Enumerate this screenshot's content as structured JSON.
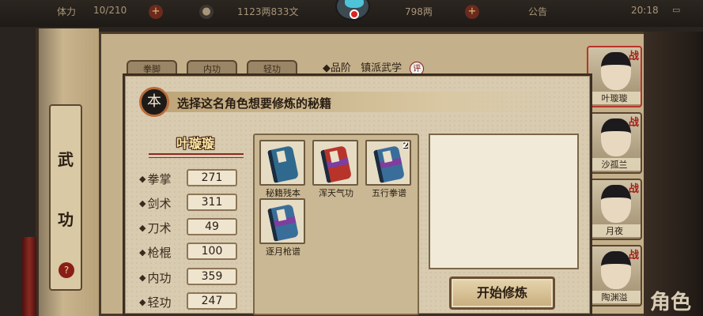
{
  "topbar": {
    "stamina": "10/210",
    "coins": "1123两833文",
    "gems": "798两",
    "notice": "公告",
    "clock": "20:18"
  },
  "scroll": {
    "label_1": "武",
    "label_2": "功",
    "help_icon": "?"
  },
  "background_panel": {
    "tabs": [
      "拳脚",
      "内功",
      "轻功"
    ],
    "grade_label": "◆品阶",
    "grade_value": "镇派武学",
    "grade_seal": "评"
  },
  "roster": [
    {
      "name": "叶璇璇",
      "mark": "战"
    },
    {
      "name": "沙孤兰",
      "mark": "战"
    },
    {
      "name": "月夜",
      "mark": "战"
    },
    {
      "name": "陶渊溢",
      "mark": "战"
    }
  ],
  "corner_text": "角色",
  "dialog": {
    "badge": "本",
    "title": "选择这名角色想要修炼的秘籍",
    "character": "叶璇璇",
    "stats": [
      {
        "label": "拳掌",
        "value": "271"
      },
      {
        "label": "剑术",
        "value": "311"
      },
      {
        "label": "刀术",
        "value": "49"
      },
      {
        "label": "枪棍",
        "value": "100"
      },
      {
        "label": "内功",
        "value": "359"
      },
      {
        "label": "轻功",
        "value": "247"
      }
    ],
    "books": [
      {
        "name": "秘籍残本",
        "count": "",
        "color": "#2f6a8e",
        "band": "#2f6a8e"
      },
      {
        "name": "浑天气功",
        "count": "",
        "color": "#b8342a",
        "band": "#7d3ea0"
      },
      {
        "name": "五行拳谱",
        "count": "2",
        "color": "#3a6e9a",
        "band": "#7d3ea0"
      },
      {
        "name": "逐月枪谱",
        "count": "",
        "color": "#3a6e9a",
        "band": "#7d3ea0"
      }
    ],
    "start_button": "开始修炼"
  }
}
